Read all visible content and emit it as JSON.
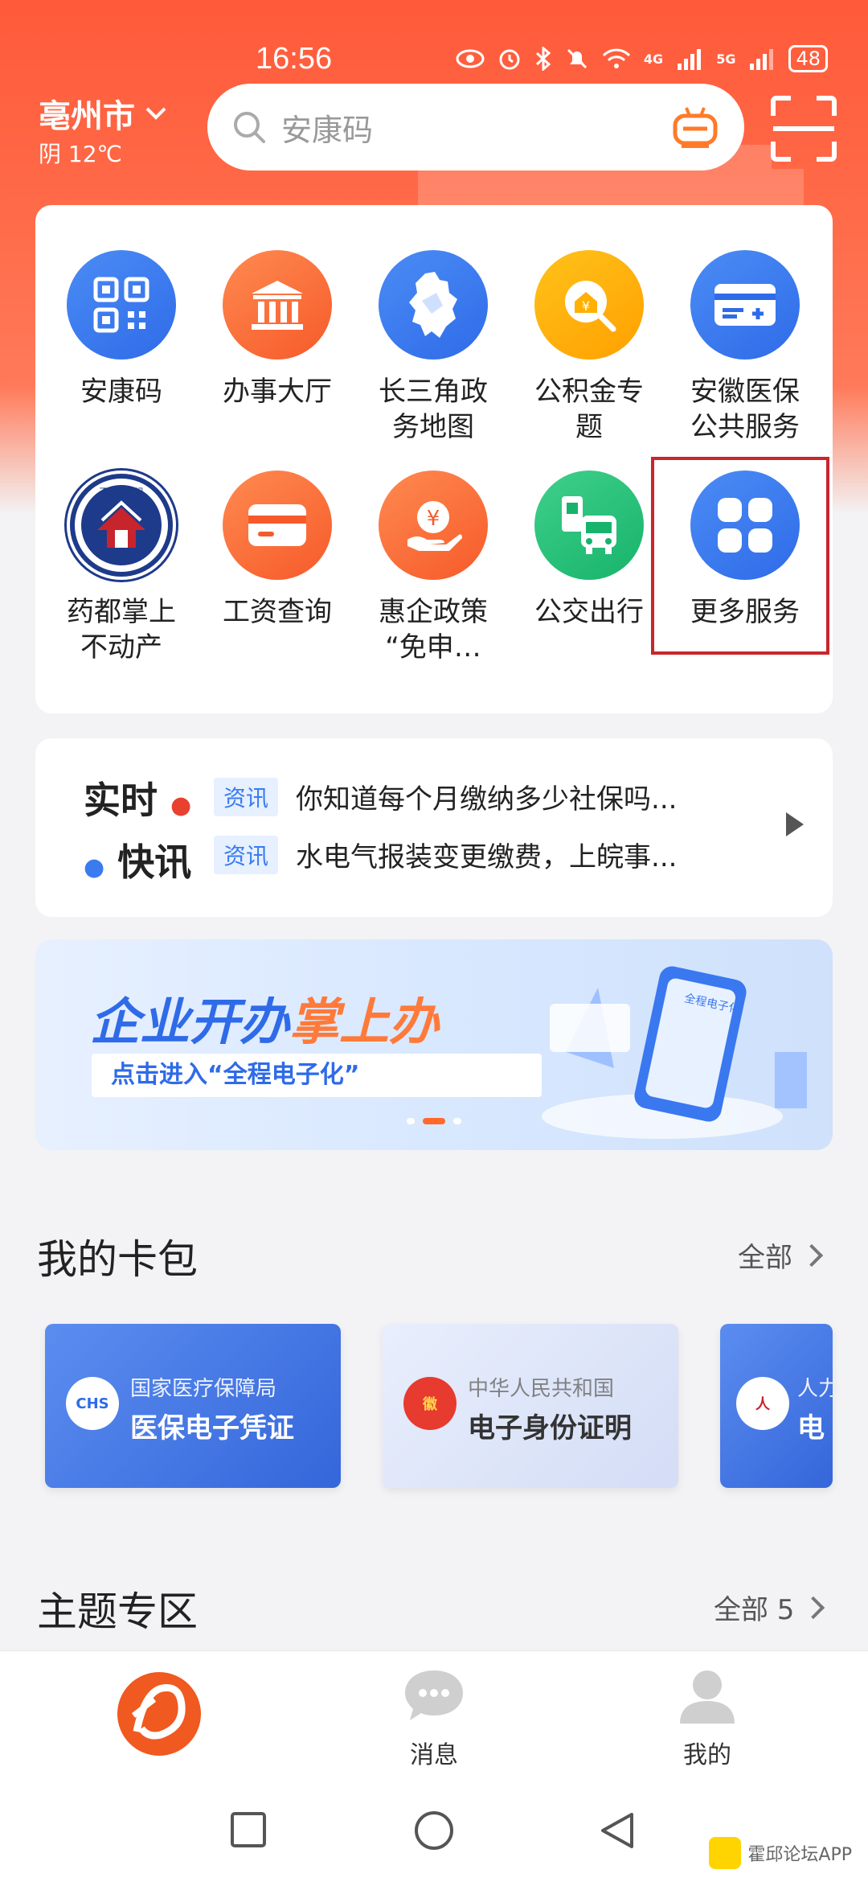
{
  "status_bar": {
    "time": "16:56",
    "signal_4g": "4G",
    "signal_5g": "5G",
    "battery": "48"
  },
  "header": {
    "city": "亳州市",
    "weather": "阴 12℃",
    "search_placeholder": "安康码"
  },
  "services": [
    {
      "label": "安康码",
      "icon": "qr-code-icon"
    },
    {
      "label": "办事大厅",
      "icon": "hall-building-icon"
    },
    {
      "label": "长三角政务地图",
      "icon": "map-icon"
    },
    {
      "label": "公积金专题",
      "icon": "housing-fund-icon"
    },
    {
      "label": "安徽医保公共服务",
      "icon": "medical-card-icon"
    },
    {
      "label": "药都掌上不动产",
      "icon": "real-estate-seal-icon"
    },
    {
      "label": "工资查询",
      "icon": "wallet-card-icon"
    },
    {
      "label": "惠企政策“免申…",
      "icon": "yuan-hand-icon"
    },
    {
      "label": "公交出行",
      "icon": "bus-icon"
    },
    {
      "label": "更多服务",
      "icon": "grid-more-icon"
    }
  ],
  "services_display": [
    [
      "安康码"
    ],
    [
      "办事大厅"
    ],
    [
      "长三角政",
      "务地图"
    ],
    [
      "公积金专",
      "题"
    ],
    [
      "安徽医保",
      "公共服务"
    ],
    [
      "药都掌上",
      "不动产"
    ],
    [
      "工资查询"
    ],
    [
      "惠企政策",
      "“免申…"
    ],
    [
      "公交出行"
    ],
    [
      "更多服务"
    ]
  ],
  "seal_text": "不动产登记",
  "news": {
    "brand_line1": "实时",
    "brand_line2": "快讯",
    "items": [
      {
        "tag": "资讯",
        "text": "你知道每个月缴纳多少社保吗..."
      },
      {
        "tag": "资讯",
        "text": "水电气报装变更缴费，上皖事..."
      }
    ]
  },
  "banner": {
    "title_blue": "企业开办",
    "title_orange": "掌上办",
    "subtitle": "点击进入“全程电子化”",
    "phone_label": "全程电子化"
  },
  "wallet": {
    "title": "我的卡包",
    "more": "全部",
    "cards": [
      {
        "logo": "CHS",
        "org": "国家医疗保障局",
        "name": "医保电子凭证"
      },
      {
        "logo": "徽",
        "org": "中华人民共和国",
        "name": "电子身份证明"
      },
      {
        "logo": "人",
        "org": "人力",
        "name": "电"
      }
    ]
  },
  "topics": {
    "title": "主题专区",
    "more": "全部 5"
  },
  "tabbar": {
    "tabs": [
      {
        "label": "",
        "icon": "home-logo-icon"
      },
      {
        "label": "消息",
        "icon": "message-bubble-icon"
      },
      {
        "label": "我的",
        "icon": "person-icon"
      }
    ]
  },
  "watermark": "霍邱论坛APP",
  "colors": {
    "brand_red": "#ff5a3a",
    "accent_blue": "#2f6be8",
    "highlight_border": "#c9262e"
  }
}
